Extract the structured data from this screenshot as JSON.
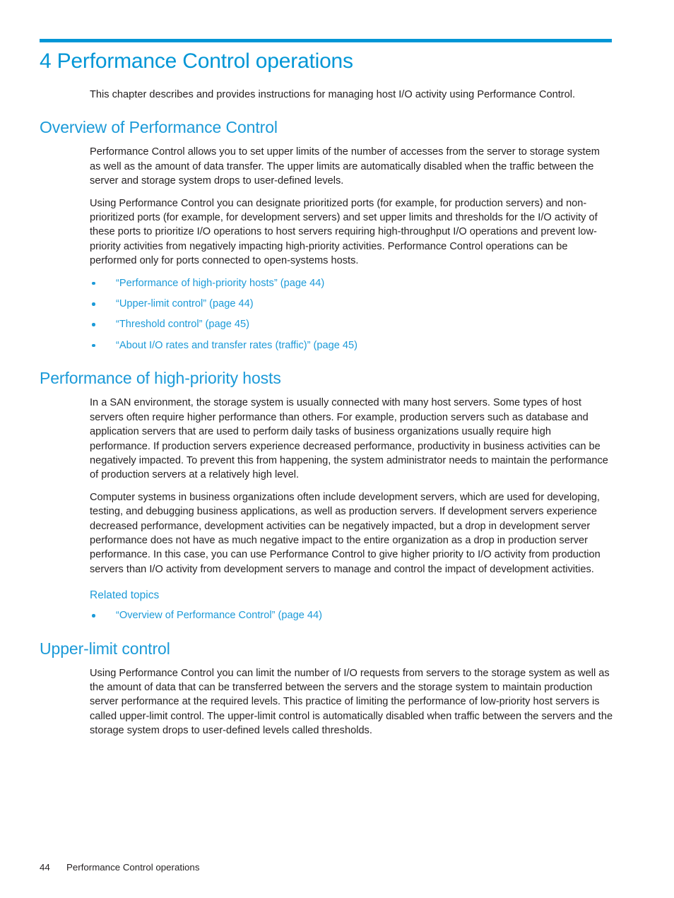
{
  "document": {
    "chapter_number": "4",
    "chapter_title": "4 Performance Control operations",
    "accent_color": "#0096d6",
    "heading_color": "#1b9ad8",
    "body_color": "#231f20"
  },
  "intro": {
    "paragraph": "This chapter describes and provides instructions for managing host I/O activity using Performance Control."
  },
  "sections": {
    "overview": {
      "heading": "Overview of Performance Control",
      "paragraph_1": "Performance Control allows you to set upper limits of the number of accesses from the server to storage system as well as the amount of data transfer. The upper limits are automatically disabled when the traffic between the server and storage system drops to user-defined levels.",
      "paragraph_2": "Using Performance Control you can designate prioritized ports (for example, for production servers) and non-prioritized ports (for example, for development servers) and set upper limits and thresholds for the I/O activity of these ports to prioritize I/O operations to host servers requiring high-throughput I/O operations and prevent low-priority activities from negatively impacting high-priority activities. Performance Control operations can be performed only for ports connected to open-systems hosts.",
      "links": [
        "“Performance of high-priority hosts” (page 44)",
        "“Upper-limit control” (page 44)",
        "“Threshold control” (page 45)",
        "“About I/O rates and transfer rates (traffic)” (page 45)"
      ]
    },
    "high_priority_hosts": {
      "heading": "Performance of high-priority hosts",
      "paragraph_1": "In a SAN environment, the storage system is usually connected with many host servers. Some types of host servers often require higher performance than others. For example, production servers such as database and application servers that are used to perform daily tasks of business organizations usually require high performance. If production servers experience decreased performance, productivity in business activities can be negatively impacted. To prevent this from happening, the system administrator needs to maintain the performance of production servers at a relatively high level.",
      "paragraph_2": "Computer systems in business organizations often include development servers, which are used for developing, testing, and debugging business applications, as well as production servers. If development servers experience decreased performance, development activities can be negatively impacted, but a drop in development server performance does not have as much negative impact to the entire organization as a drop in production server performance. In this case, you can use Performance Control to give higher priority to I/O activity from production servers than I/O activity from development servers to manage and control the impact of development activities.",
      "related_topics_label": "Related topics",
      "related_links": [
        "“Overview of Performance Control” (page 44)"
      ]
    },
    "upper_limit_control": {
      "heading": "Upper-limit control",
      "paragraph_1": "Using Performance Control you can limit the number of I/O requests from servers to the storage system as well as the amount of data that can be transferred between the servers and the storage system to maintain production server performance at the required levels. This practice of limiting the performance of low-priority host servers is called upper-limit control. The upper-limit control is automatically disabled when traffic between the servers and the storage system drops to user-defined levels called thresholds."
    }
  },
  "footer": {
    "page_number": "44",
    "chapter_label": "Performance Control operations"
  }
}
